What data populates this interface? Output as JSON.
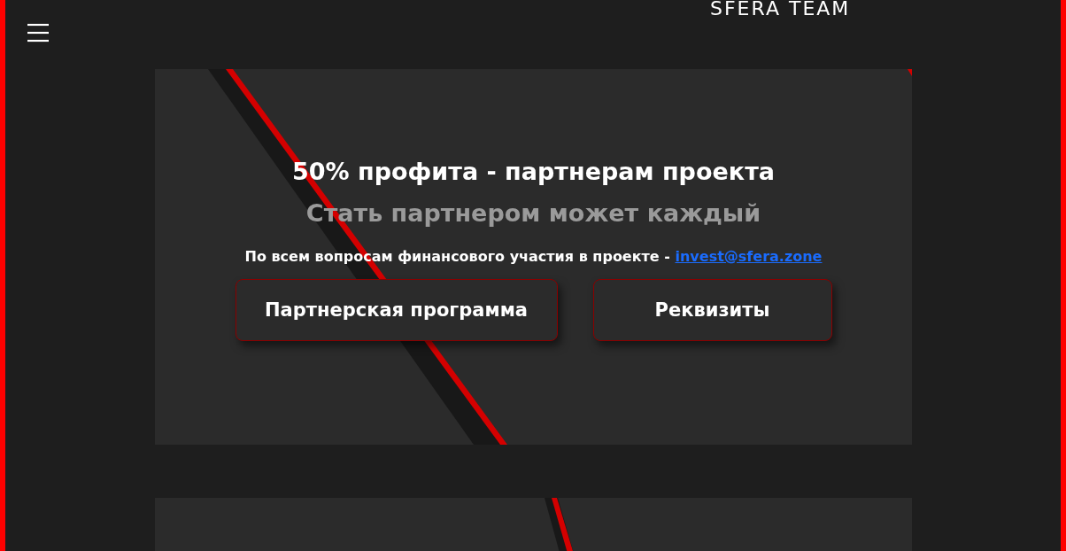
{
  "header": {
    "logo": "SFERA TEAM"
  },
  "promo": {
    "title": "50% профита - партнерам проекта",
    "subtitle": "Стать партнером может каждый",
    "contact_text": "По всем вопросам финансового участия в проекте - ",
    "contact_link": "invest@sfera.zone",
    "buttons": [
      "Партнерская программа",
      "Реквизиты"
    ]
  }
}
